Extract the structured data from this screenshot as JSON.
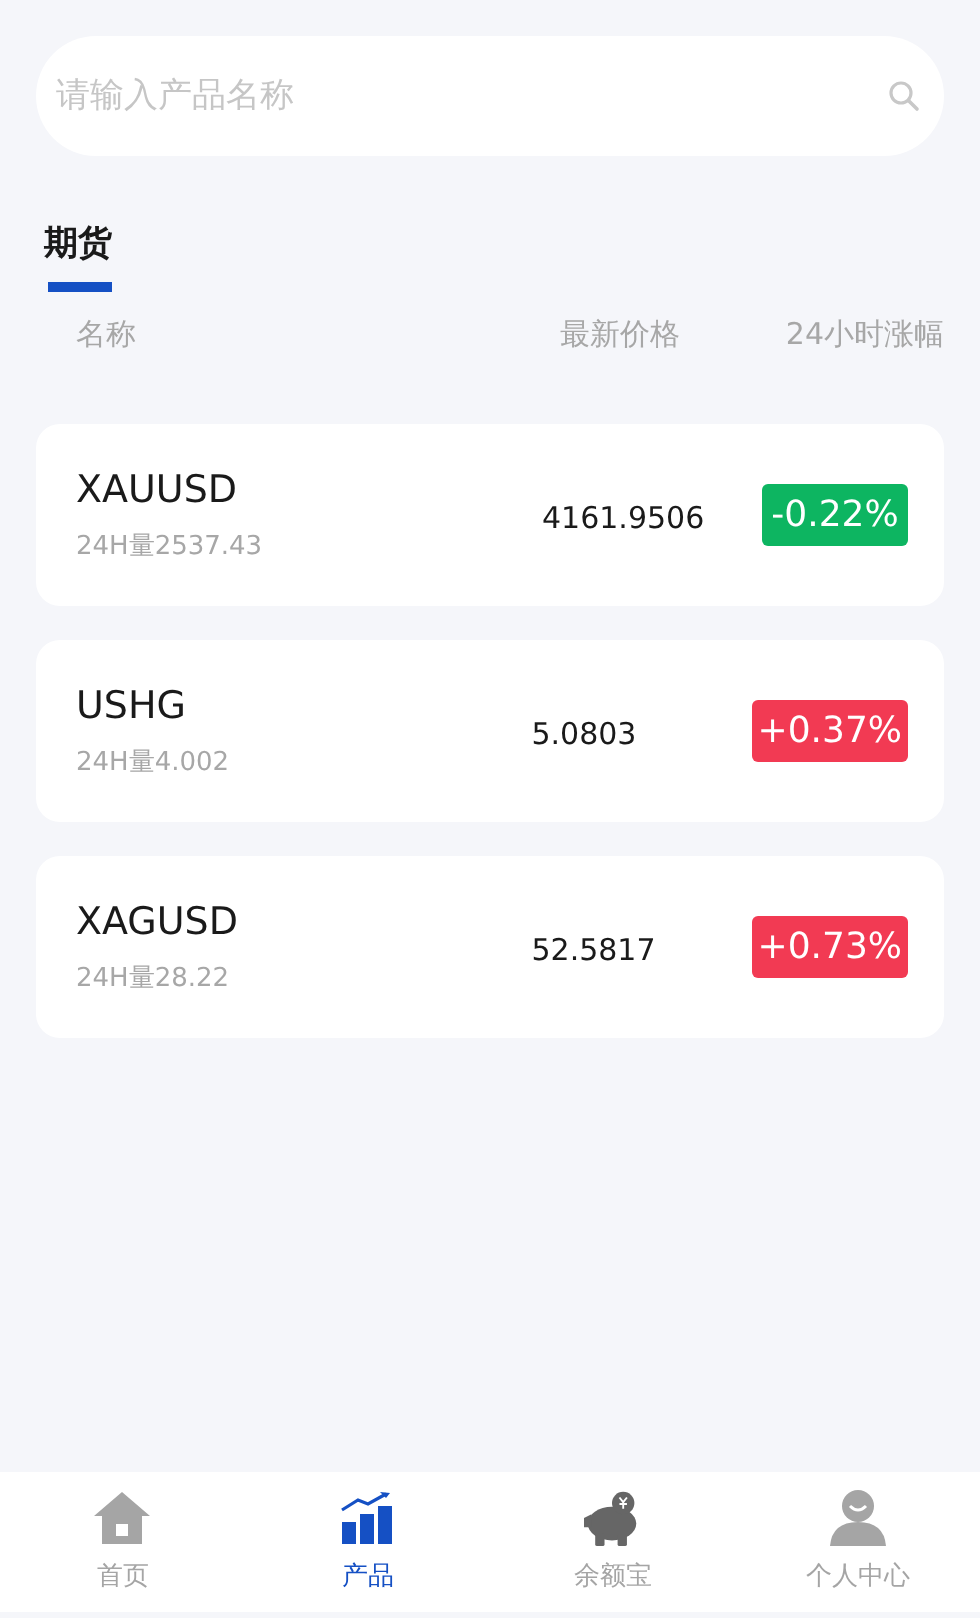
{
  "search": {
    "placeholder": "请输入产品名称"
  },
  "tabs": [
    {
      "label": "期货",
      "selected": true
    }
  ],
  "table": {
    "columns": [
      "名称",
      "最新价格",
      "24小时涨幅"
    ],
    "rows": [
      {
        "name": "XAUUSD",
        "volume": "24H量2537.43",
        "price": "4161.9506",
        "change": "-0.22%",
        "color": "#0db561"
      },
      {
        "name": "USHG",
        "volume": "24H量4.002",
        "price": "5.0803",
        "change": "+0.37%",
        "color": "#f23a53"
      },
      {
        "name": "XAGUSD",
        "volume": "24H量28.22",
        "price": "52.5817",
        "change": "+0.73%",
        "color": "#f23a53"
      }
    ]
  },
  "nav": [
    {
      "label": "首页",
      "kind": "home",
      "selected": false
    },
    {
      "label": "产品",
      "kind": "products",
      "selected": true
    },
    {
      "label": "余额宝",
      "kind": "piggy",
      "selected": false
    },
    {
      "label": "个人中心",
      "kind": "profile",
      "selected": false
    }
  ]
}
